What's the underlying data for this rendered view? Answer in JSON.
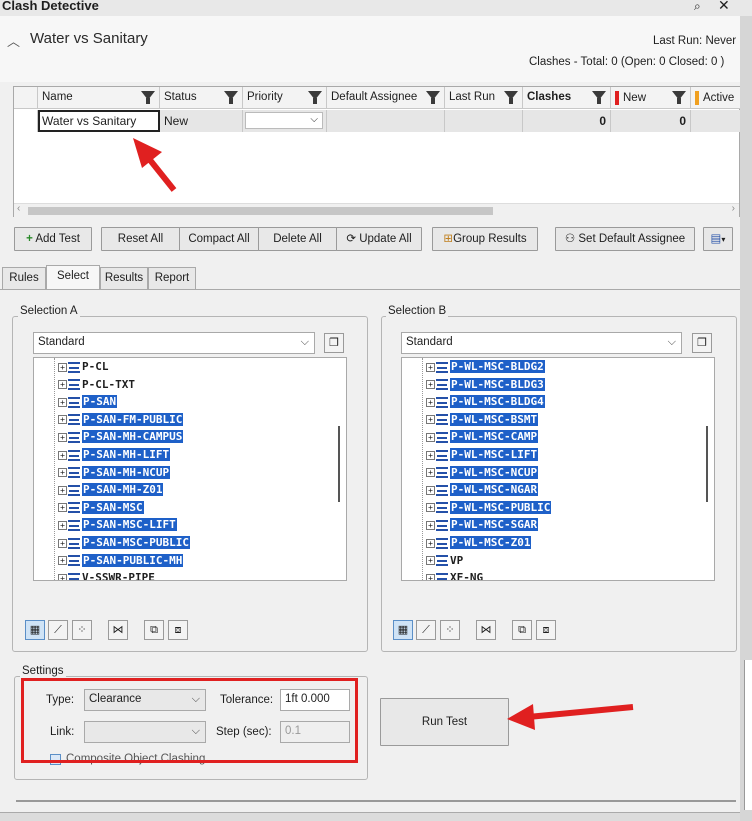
{
  "window": {
    "title": "Clash Detective"
  },
  "header": {
    "test_name": "Water vs Sanitary",
    "last_run_label": "Last Run:",
    "last_run_value": "Never",
    "summary": "Clashes - Total: 0 (Open: 0 Closed: 0 )"
  },
  "table": {
    "columns": [
      "Name",
      "Status",
      "Priority",
      "Default Assignee",
      "Last Run",
      "Clashes",
      "New",
      "Active"
    ],
    "row": {
      "name": "Water vs Sanitary",
      "status": "New",
      "priority": "",
      "assignee": "",
      "last_run": "",
      "clashes": "0",
      "new": "0",
      "active": ""
    }
  },
  "toolbar": {
    "add_test": "Add Test",
    "reset_all": "Reset All",
    "compact_all": "Compact All",
    "delete_all": "Delete All",
    "update_all": "Update All",
    "group_results": "Group Results",
    "set_default_assignee": "Set Default Assignee"
  },
  "tabs": [
    "Rules",
    "Select",
    "Results",
    "Report"
  ],
  "selection_a": {
    "title": "Selection A",
    "mode": "Standard",
    "items": [
      {
        "label": "P-CL",
        "selected": false
      },
      {
        "label": "P-CL-TXT",
        "selected": false
      },
      {
        "label": "P-SAN",
        "selected": true
      },
      {
        "label": "P-SAN-FM-PUBLIC",
        "selected": true
      },
      {
        "label": "P-SAN-MH-CAMPUS",
        "selected": true
      },
      {
        "label": "P-SAN-MH-LIFT",
        "selected": true
      },
      {
        "label": "P-SAN-MH-NCUP",
        "selected": true
      },
      {
        "label": "P-SAN-MH-Z01",
        "selected": true
      },
      {
        "label": "P-SAN-MSC",
        "selected": true
      },
      {
        "label": "P-SAN-MSC-LIFT",
        "selected": true
      },
      {
        "label": "P-SAN-MSC-PUBLIC",
        "selected": true
      },
      {
        "label": "P-SAN-PUBLIC-MH",
        "selected": true
      },
      {
        "label": "V-SSWR-PIPE",
        "selected": false
      }
    ]
  },
  "selection_b": {
    "title": "Selection B",
    "mode": "Standard",
    "items": [
      {
        "label": "P-WL-MSC-BLDG2",
        "selected": true
      },
      {
        "label": "P-WL-MSC-BLDG3",
        "selected": true
      },
      {
        "label": "P-WL-MSC-BLDG4",
        "selected": true
      },
      {
        "label": "P-WL-MSC-BSMT",
        "selected": true
      },
      {
        "label": "P-WL-MSC-CAMP",
        "selected": true
      },
      {
        "label": "P-WL-MSC-LIFT",
        "selected": true
      },
      {
        "label": "P-WL-MSC-NCUP",
        "selected": true
      },
      {
        "label": "P-WL-MSC-NGAR",
        "selected": true
      },
      {
        "label": "P-WL-MSC-PUBLIC",
        "selected": true
      },
      {
        "label": "P-WL-MSC-SGAR",
        "selected": true
      },
      {
        "label": "P-WL-MSC-Z01",
        "selected": true
      },
      {
        "label": "VP",
        "selected": false
      },
      {
        "label": "XF-NG",
        "selected": false
      }
    ]
  },
  "settings": {
    "title": "Settings",
    "type_label": "Type:",
    "type_value": "Clearance",
    "tolerance_label": "Tolerance:",
    "tolerance_value": "1ft 0.000",
    "link_label": "Link:",
    "link_value": "",
    "step_label": "Step (sec):",
    "step_value": "0.1",
    "composite_label": "Composite Object Clashing"
  },
  "run_test": "Run Test",
  "colors": {
    "selection": "#1e60c8",
    "annotation": "#e02020",
    "new_marker": "#e02020",
    "active_marker": "#f0a020"
  }
}
